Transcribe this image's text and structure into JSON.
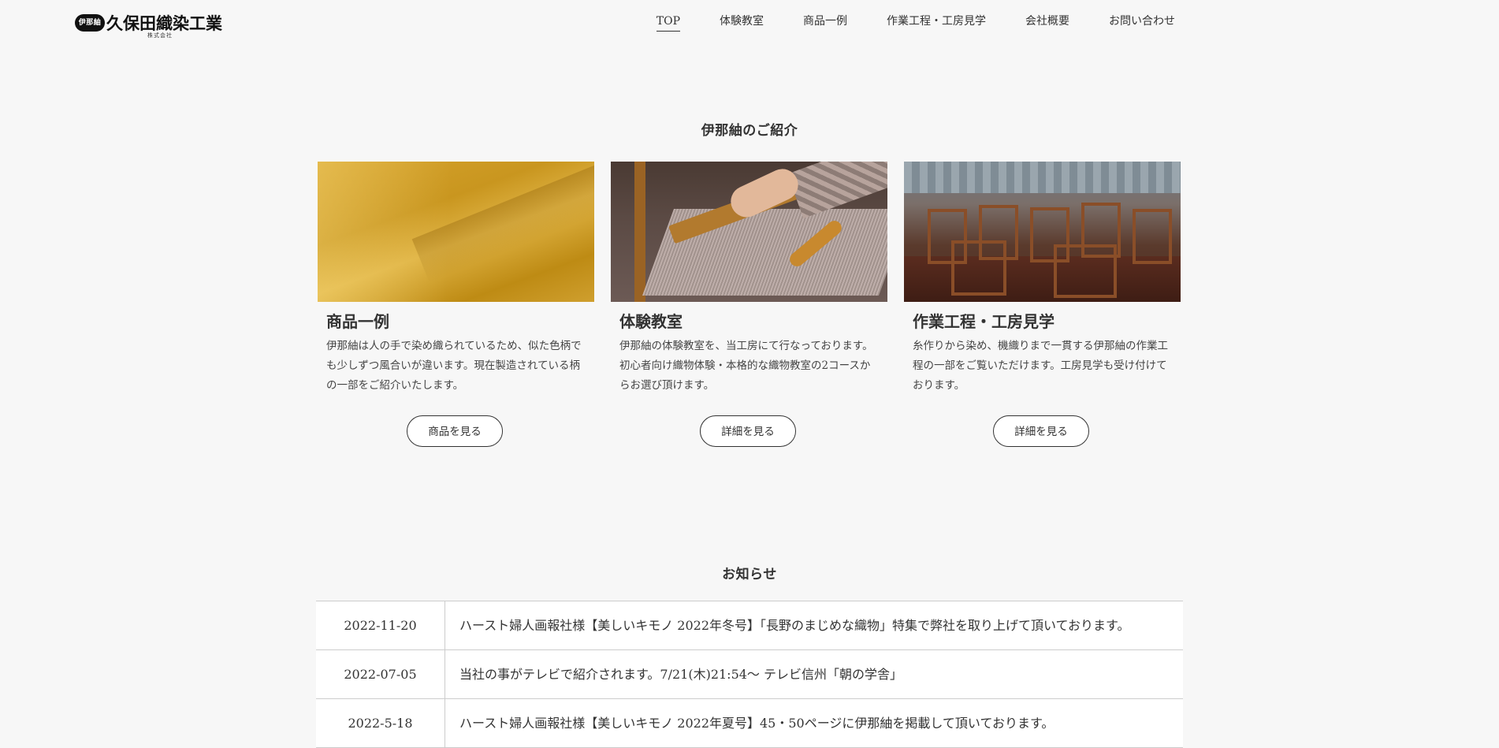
{
  "header": {
    "logo": {
      "badge": "伊那紬",
      "main": "久保田織染工業",
      "sub": "株式会社"
    },
    "nav": [
      {
        "label": "TOP",
        "active": true
      },
      {
        "label": "体験教室",
        "active": false
      },
      {
        "label": "商品一例",
        "active": false
      },
      {
        "label": "作業工程・工房見学",
        "active": false
      },
      {
        "label": "会社概要",
        "active": false
      },
      {
        "label": "お問い合わせ",
        "active": false
      }
    ]
  },
  "intro": {
    "title": "伊那紬のご紹介",
    "cards": [
      {
        "image": "silk-fabric-image",
        "title": "商品一例",
        "text": "伊那紬は人の手で染め織られているため、似た色柄でも少しずつ風合いが違います。現在製造されている柄の一部をご紹介いたします。",
        "button": "商品を見る"
      },
      {
        "image": "loom-weaving-image",
        "title": "体験教室",
        "text": "伊那紬の体験教室を、当工房にて行なっております。初心者向け織物体験・本格的な織物教室の2コースからお選び頂けます。",
        "button": "詳細を見る"
      },
      {
        "image": "workshop-image",
        "title": "作業工程・工房見学",
        "text": "糸作りから染め、機織りまで一貫する伊那紬の作業工程の一部をご覧いただけます。工房見学も受け付けております。",
        "button": "詳細を見る"
      }
    ]
  },
  "news": {
    "title": "お知らせ",
    "items": [
      {
        "date": "2022-11-20",
        "text": "ハースト婦人画報社様【美しいキモノ 2022年冬号】「長野のまじめな織物」特集で弊社を取り上げて頂いております。"
      },
      {
        "date": "2022-07-05",
        "text": "当社の事がテレビで紹介されます。7/21(木)21:54～ テレビ信州「朝の学舎」"
      },
      {
        "date": "2022-5-18",
        "text": "ハースト婦人画報社様【美しいキモノ 2022年夏号】45・50ページに伊那紬を掲載して頂いております。"
      }
    ]
  }
}
